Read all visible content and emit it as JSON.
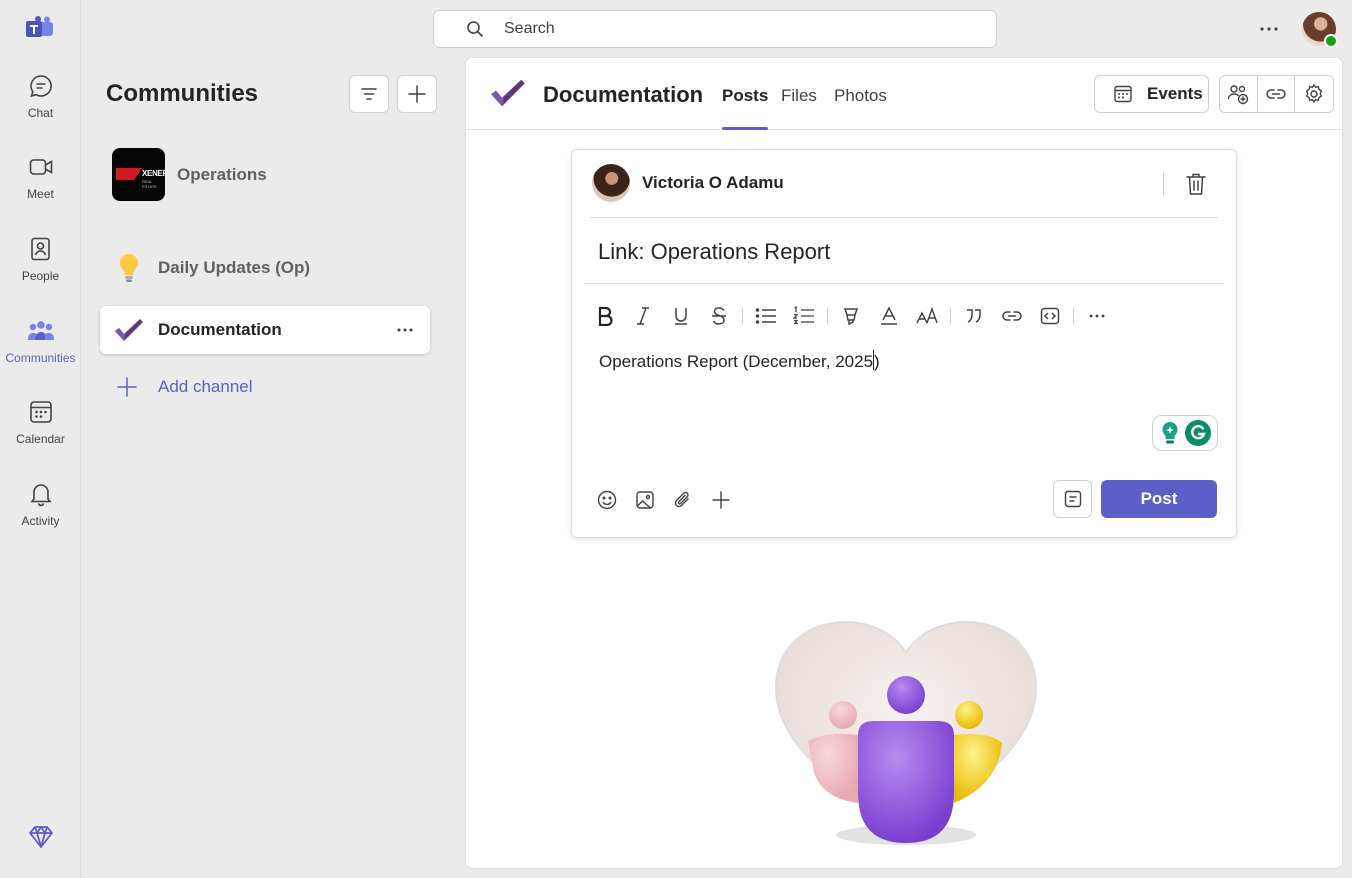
{
  "rail": {
    "items": [
      {
        "label": "Chat",
        "icon": "chat-icon"
      },
      {
        "label": "Meet",
        "icon": "video-icon"
      },
      {
        "label": "People",
        "icon": "people-book-icon"
      },
      {
        "label": "Communities",
        "icon": "communities-icon"
      },
      {
        "label": "Calendar",
        "icon": "calendar-icon"
      },
      {
        "label": "Activity",
        "icon": "bell-icon"
      }
    ],
    "active": "Communities"
  },
  "search": {
    "placeholder": "Search"
  },
  "panel": {
    "title": "Communities",
    "community": {
      "name": "Operations",
      "logo_text": "XENERO",
      "logo_sub": "REAL ESTATE"
    },
    "channels": [
      {
        "name": "Daily Updates (Op)",
        "icon": "lightbulb-icon"
      },
      {
        "name": "Documentation",
        "icon": "checkmark-icon"
      }
    ],
    "add_channel": "Add channel"
  },
  "main": {
    "channel_name": "Documentation",
    "tabs": [
      "Posts",
      "Files",
      "Photos"
    ],
    "active_tab": "Posts",
    "events_label": "Events"
  },
  "composer": {
    "author": "Victoria O Adamu",
    "subject": "Link: Operations Report",
    "body_before_caret": "Operations Report (December, 2025",
    "body_after_caret": ")",
    "post_label": "Post"
  },
  "colors": {
    "accent": "#5b5fc7",
    "presence": "#13a10e",
    "rail_bg": "#ebebeb"
  }
}
